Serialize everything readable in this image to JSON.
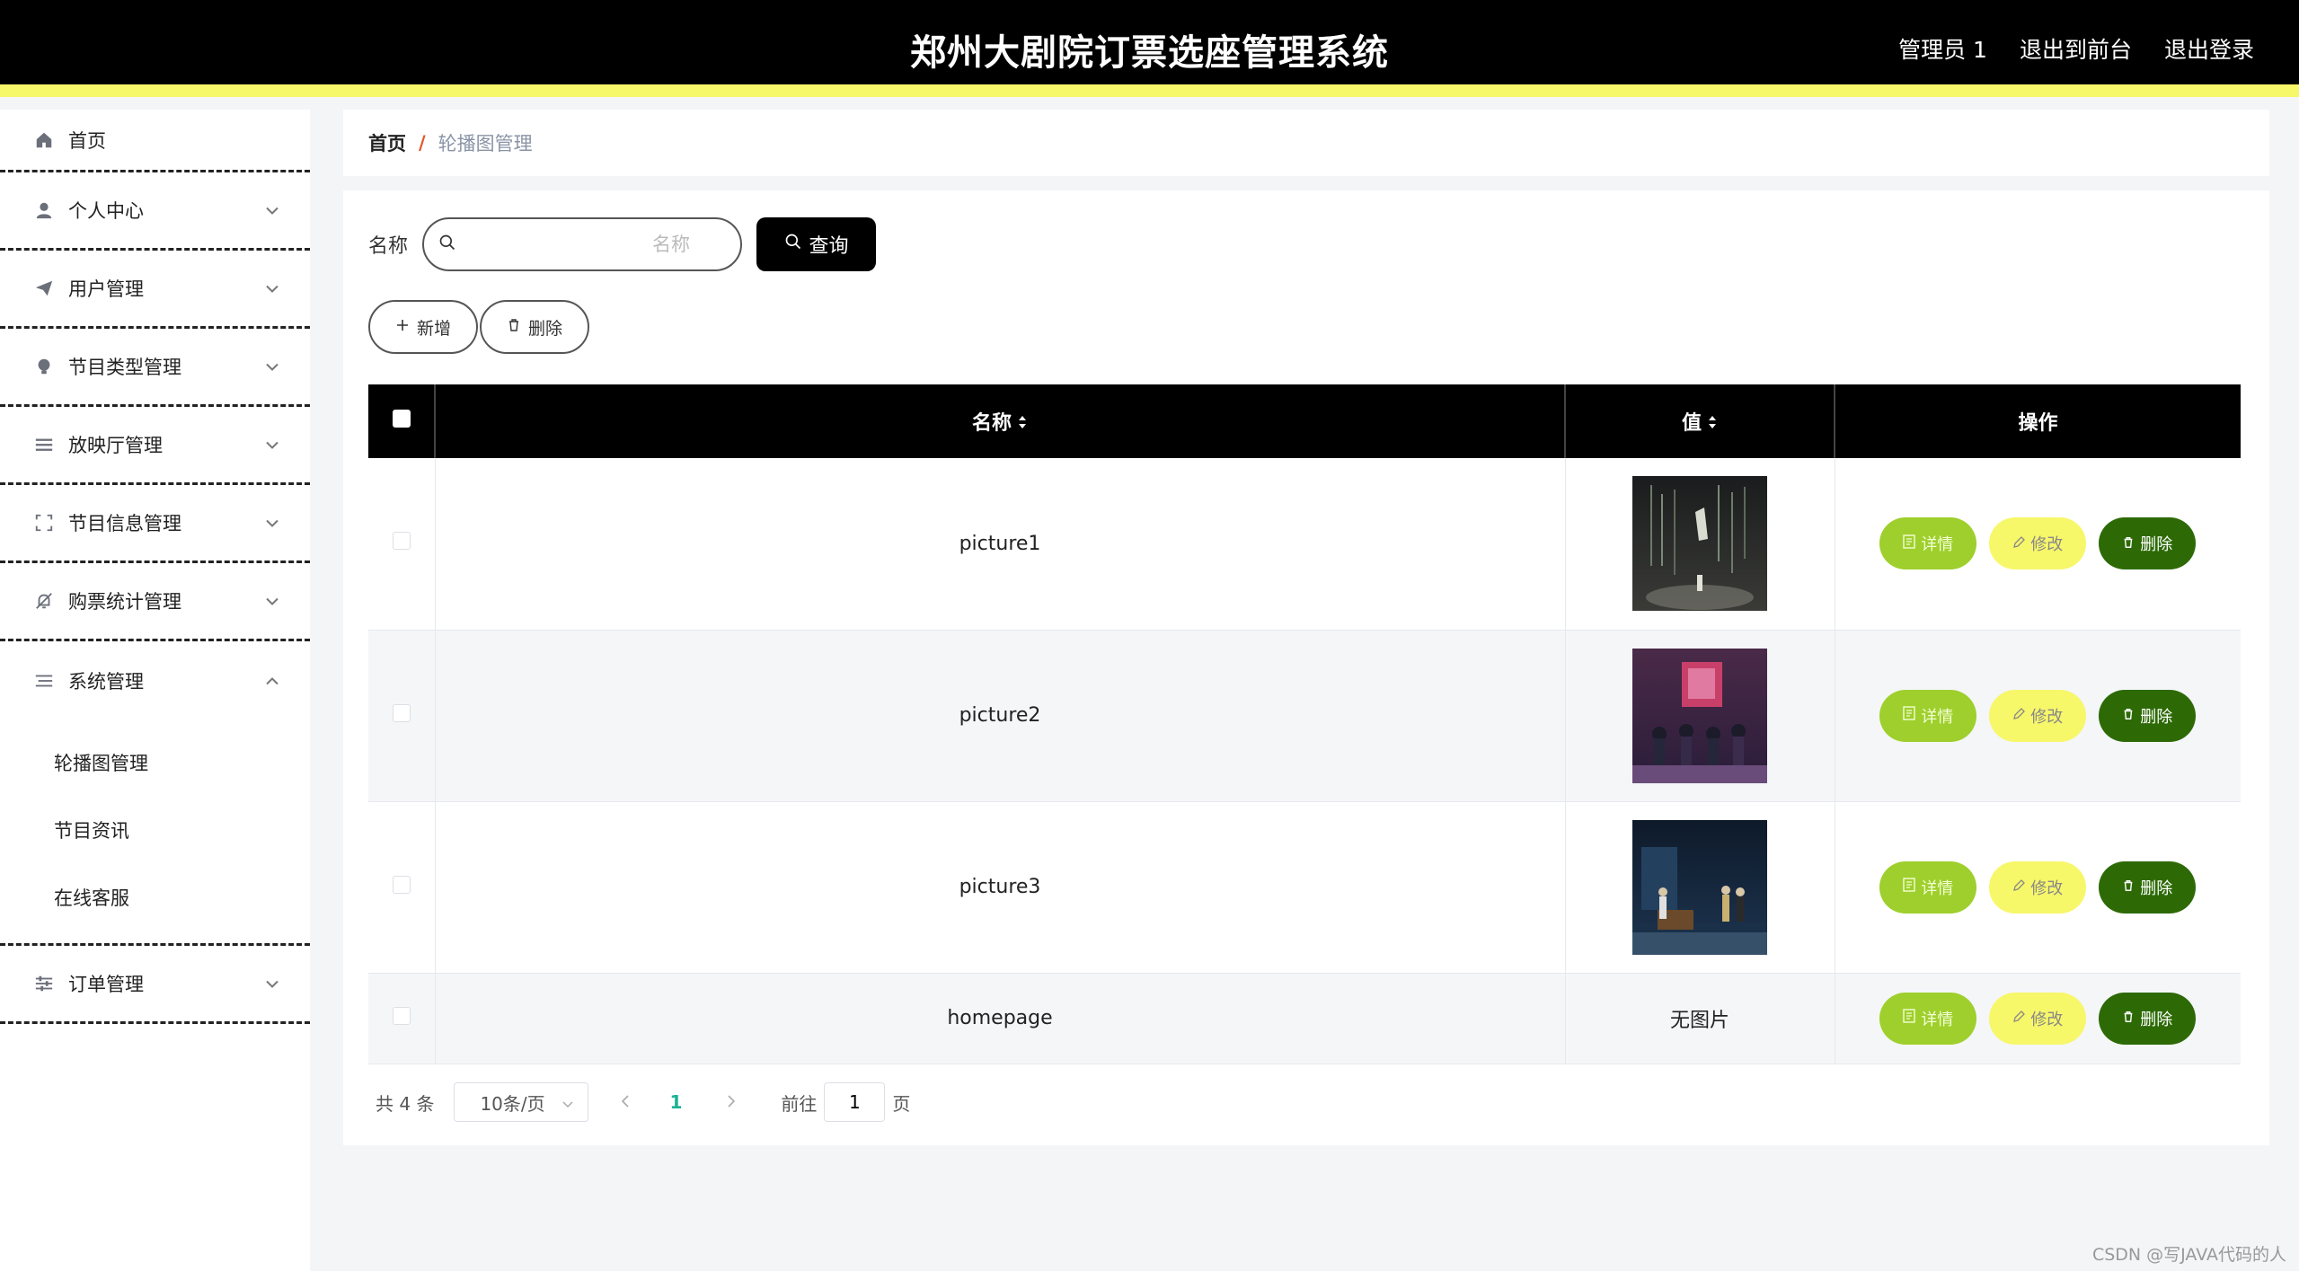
{
  "header": {
    "title": "郑州大剧院订票选座管理系统",
    "links": [
      "管理员 1",
      "退出到前台",
      "退出登录"
    ]
  },
  "sidebar": {
    "items": [
      {
        "label": "首页",
        "icon": "home-icon"
      },
      {
        "label": "个人中心",
        "icon": "user-icon"
      },
      {
        "label": "用户管理",
        "icon": "send-icon"
      },
      {
        "label": "节目类型管理",
        "icon": "bulb-icon"
      },
      {
        "label": "放映厅管理",
        "icon": "list-icon"
      },
      {
        "label": "节目信息管理",
        "icon": "fullscreen-icon"
      },
      {
        "label": "购票统计管理",
        "icon": "bell-off-icon"
      },
      {
        "label": "系统管理",
        "icon": "menu-icon"
      },
      {
        "label": "订单管理",
        "icon": "sliders-icon"
      }
    ],
    "system_submenu": [
      "轮播图管理",
      "节目资讯",
      "在线客服"
    ]
  },
  "breadcrumb": {
    "home": "首页",
    "separator": "/",
    "current": "轮播图管理"
  },
  "search": {
    "label": "名称",
    "placeholder": "名称",
    "button": "查询"
  },
  "actions": {
    "add": "新增",
    "delete": "删除"
  },
  "table": {
    "headers": {
      "name": "名称",
      "value": "值",
      "ops": "操作"
    },
    "rows": [
      {
        "name": "picture1",
        "value_image": "stage-image-1"
      },
      {
        "name": "picture2",
        "value_image": "stage-image-2"
      },
      {
        "name": "picture3",
        "value_image": "stage-image-3"
      },
      {
        "name": "homepage",
        "value_text": "无图片"
      }
    ],
    "op_labels": {
      "detail": "详情",
      "edit": "修改",
      "delete": "删除"
    }
  },
  "pagination": {
    "total": "共 4 条",
    "page_size": "10条/页",
    "current_page": "1",
    "goto_label": "前往",
    "goto_value": "1",
    "page_suffix": "页"
  },
  "watermark": "CSDN @写JAVA代码的人"
}
